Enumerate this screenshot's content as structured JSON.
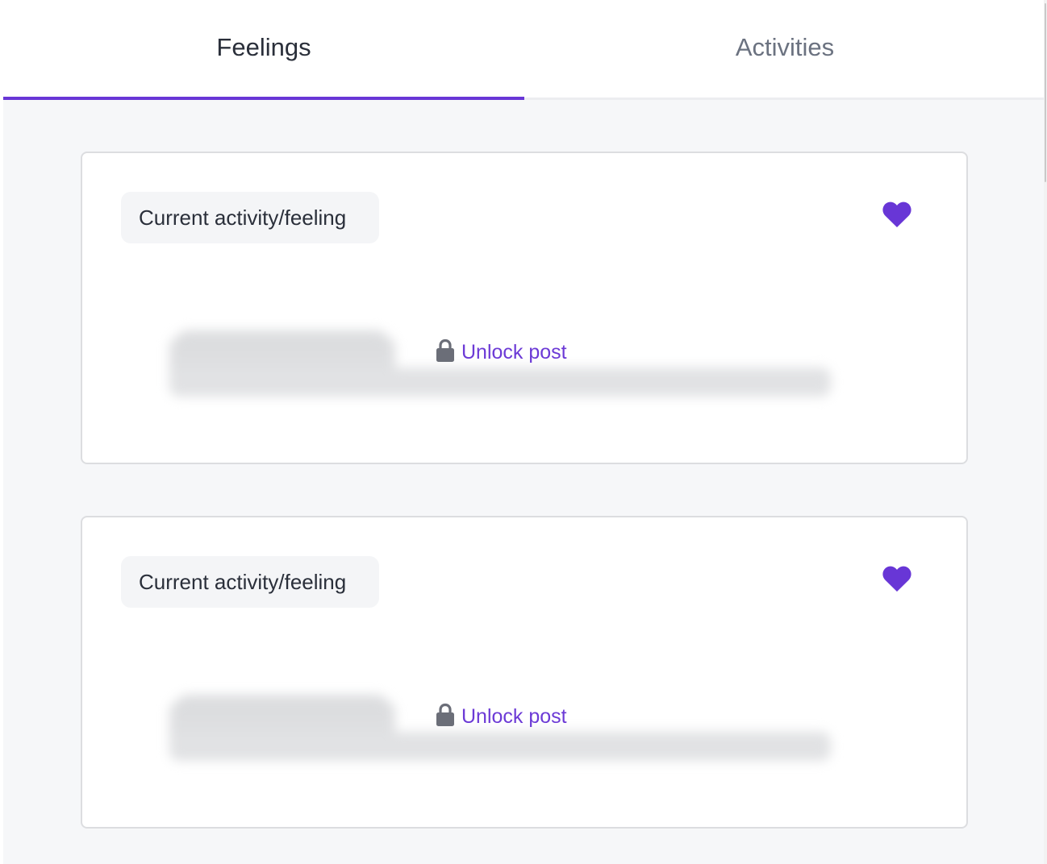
{
  "tabs": [
    {
      "label": "Feelings",
      "active": true
    },
    {
      "label": "Activities",
      "active": false
    }
  ],
  "colors": {
    "accent": "#6836d6",
    "background": "#f6f7f9",
    "lock_gray": "#6b6e78"
  },
  "posts": [
    {
      "chip_label": "Current activity/feeling",
      "icon": "heart-icon",
      "unlock_label": "Unlock post"
    },
    {
      "chip_label": "Current activity/feeling",
      "icon": "heart-icon",
      "unlock_label": "Unlock post"
    }
  ]
}
